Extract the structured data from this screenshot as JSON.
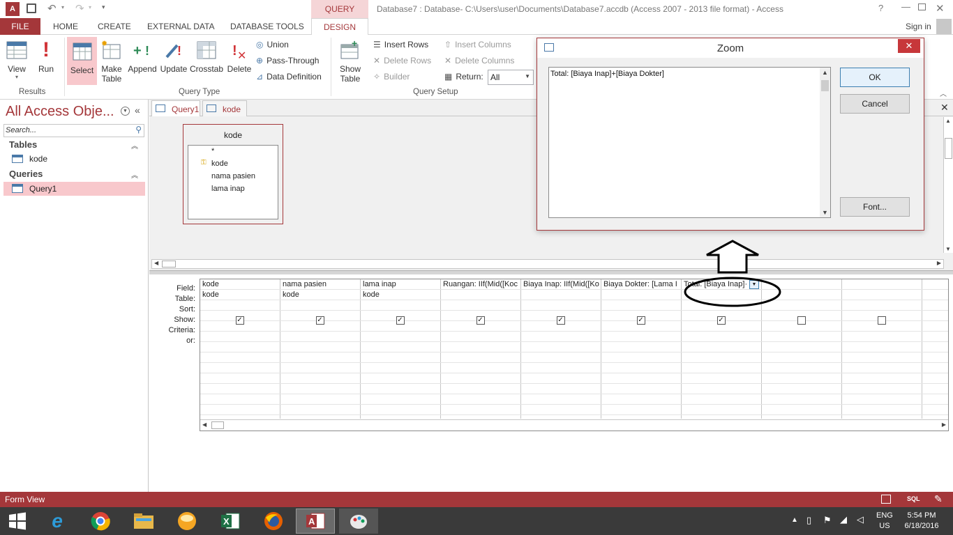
{
  "titlebar": {
    "window_title": "Database7 : Database- C:\\Users\\user\\Documents\\Database7.accdb (Access 2007 - 2013 file format) - Access",
    "context_tab": "QUERY TOOLS",
    "help": "?",
    "sign_in": "Sign in"
  },
  "ribbon_tabs": [
    "FILE",
    "HOME",
    "CREATE",
    "EXTERNAL DATA",
    "DATABASE TOOLS",
    "DESIGN"
  ],
  "ribbon": {
    "results": {
      "view": "View",
      "run": "Run",
      "label": "Results"
    },
    "query_type": {
      "select": "Select",
      "make_table_1": "Make",
      "make_table_2": "Table",
      "append": "Append",
      "update": "Update",
      "crosstab": "Crosstab",
      "delete": "Delete",
      "union": "Union",
      "pass_through": "Pass-Through",
      "data_definition": "Data Definition",
      "label": "Query Type"
    },
    "query_setup": {
      "show_table_1": "Show",
      "show_table_2": "Table",
      "insert_rows": "Insert Rows",
      "delete_rows": "Delete Rows",
      "builder": "Builder",
      "insert_columns": "Insert Columns",
      "delete_columns": "Delete Columns",
      "return_label": "Return:",
      "return_value": "All",
      "label": "Query Setup"
    }
  },
  "nav_pane": {
    "title": "All Access Obje...",
    "search_placeholder": "Search...",
    "tables_header": "Tables",
    "tables": [
      "kode"
    ],
    "queries_header": "Queries",
    "queries": [
      "Query1"
    ]
  },
  "doc_tabs": [
    "Query1",
    "kode"
  ],
  "table_box": {
    "title": "kode",
    "fields": [
      "*",
      "kode",
      "nama pasien",
      "lama inap"
    ]
  },
  "grid": {
    "row_labels": [
      "Field:",
      "Table:",
      "Sort:",
      "Show:",
      "Criteria:",
      "or:"
    ],
    "columns": [
      {
        "field": "kode",
        "table": "kode",
        "show": true
      },
      {
        "field": "nama pasien",
        "table": "kode",
        "show": true
      },
      {
        "field": "lama inap",
        "table": "kode",
        "show": true
      },
      {
        "field": "Ruangan: IIf(Mid([Koc",
        "table": "",
        "show": true
      },
      {
        "field": "Biaya Inap: IIf(Mid([Ko",
        "table": "",
        "show": true
      },
      {
        "field": "Biaya Dokter: [Lama I",
        "table": "",
        "show": true
      },
      {
        "field": "Total: [Biaya Inap]·",
        "table": "",
        "show": true
      },
      {
        "field": "",
        "table": "",
        "show": false
      },
      {
        "field": "",
        "table": "",
        "show": false
      }
    ]
  },
  "zoom_dialog": {
    "title": "Zoom",
    "text": "Total: [Biaya Inap]+[Biaya Dokter]",
    "ok": "OK",
    "cancel": "Cancel",
    "font": "Font..."
  },
  "statusbar": {
    "text": "Form View",
    "sql": "SQL"
  },
  "taskbar": {
    "lang_1": "ENG",
    "lang_2": "US",
    "time": "5:54 PM",
    "date": "6/18/2016"
  },
  "colors": {
    "access_red": "#a4373a",
    "taskbar": "#3a3a3a",
    "select_hl": "#f8c8cc"
  }
}
